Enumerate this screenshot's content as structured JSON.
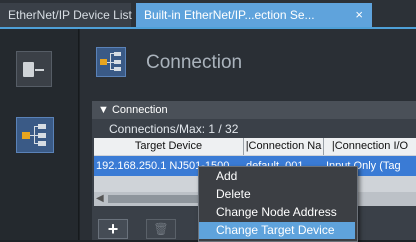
{
  "tabs": [
    {
      "label": "EtherNet/IP Device List"
    },
    {
      "label": "Built-in EtherNet/IP...ection Se...",
      "close": "×"
    }
  ],
  "page": {
    "title": "Connection"
  },
  "panel": {
    "header": "▼ Connection",
    "count_label": "Connections/Max: 1 / 32"
  },
  "table": {
    "columns": [
      "Target Device",
      "|Connection Na",
      "|Connection I/O"
    ],
    "rows": [
      {
        "target_device": "192.168.250.1 NJ501-1500",
        "connection_name": "default_001",
        "connection_io": "Input Only (Tag"
      }
    ]
  },
  "buttons": {
    "add": "+",
    "delete": "🗑"
  },
  "context_menu": {
    "items": [
      "Add",
      "Delete",
      "Change Node Address",
      "Change Target Device"
    ]
  },
  "colors": {
    "accent": "#5fa3dc",
    "selected_row": "#3a7bd5",
    "icon_orange": "#e7a51f"
  }
}
